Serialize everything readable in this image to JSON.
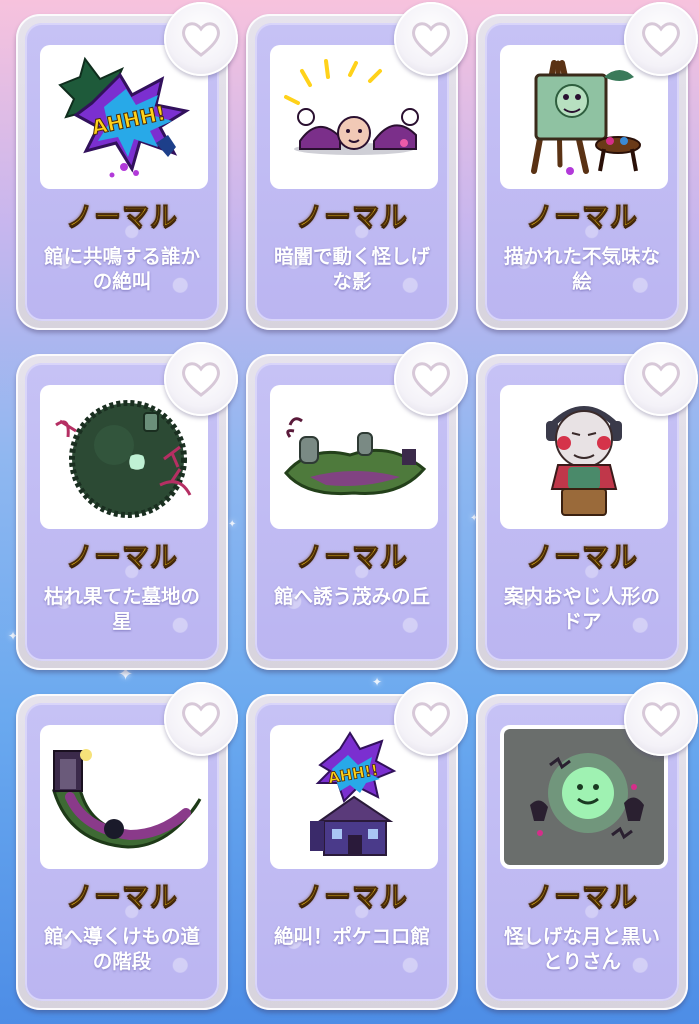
{
  "grid": {
    "cards": [
      {
        "rarity": "ノーマル",
        "title": "館に共鳴する誰かの絶叫",
        "icon": "ahhh-burst-icon",
        "favorite": "heart-outline-icon"
      },
      {
        "rarity": "ノーマル",
        "title": "暗闇で動く怪しげな影",
        "icon": "shadow-figures-icon",
        "favorite": "heart-outline-icon"
      },
      {
        "rarity": "ノーマル",
        "title": "描かれた不気味な絵",
        "icon": "easel-painting-icon",
        "favorite": "heart-outline-icon"
      },
      {
        "rarity": "ノーマル",
        "title": "枯れ果てた墓地の星",
        "icon": "graveyard-planet-icon",
        "favorite": "heart-outline-icon"
      },
      {
        "rarity": "ノーマル",
        "title": "館へ誘う茂みの丘",
        "icon": "bush-hill-icon",
        "favorite": "heart-outline-icon"
      },
      {
        "rarity": "ノーマル",
        "title": "案内おやじ人形のドア",
        "icon": "doll-door-icon",
        "favorite": "heart-outline-icon"
      },
      {
        "rarity": "ノーマル",
        "title": "館へ導くけもの道の階段",
        "icon": "path-stairs-icon",
        "favorite": "heart-outline-icon"
      },
      {
        "rarity": "ノーマル",
        "title": "絶叫！ポケコロ館",
        "icon": "haunted-mansion-icon",
        "favorite": "heart-outline-icon"
      },
      {
        "rarity": "ノーマル",
        "title": "怪しげな月と黒いとりさん",
        "icon": "ghost-moon-icon",
        "favorite": "heart-outline-icon"
      }
    ]
  },
  "colors": {
    "rarity_text": "#ffd21a",
    "card_frame": "#e6e3ec",
    "card_panel": "#c6c2f5",
    "heart_fill": "#ffffff",
    "heart_outline": "#d7c8d8"
  }
}
